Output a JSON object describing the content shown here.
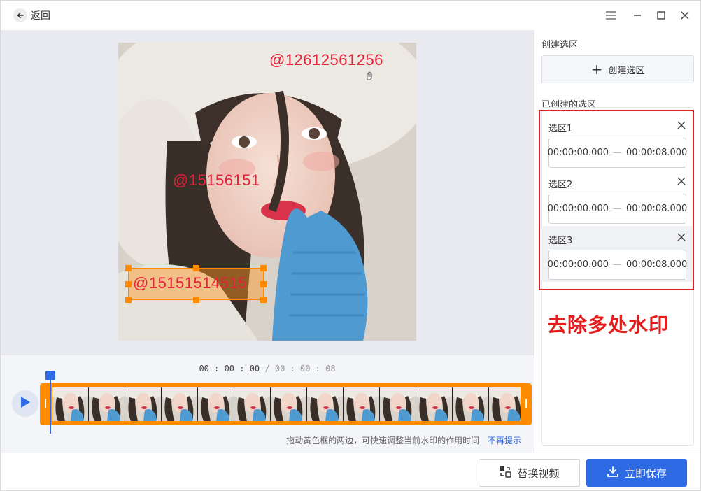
{
  "titlebar": {
    "back_label": "返回",
    "icons": [
      "back-arrow-icon",
      "menu-icon",
      "minimize-icon",
      "maximize-icon",
      "close-icon"
    ]
  },
  "preview": {
    "watermarks": [
      "@12612561256",
      "@15156151",
      "@15151514515"
    ]
  },
  "timeline": {
    "current_time": "00 : 00 : 00",
    "separator": " / ",
    "total_time": "00 : 00 : 08",
    "hint_text": "拖动黄色框的两边，可快速调整当前水印的作用时间",
    "hint_link": "不再提示"
  },
  "panel": {
    "create_section_title": "创建选区",
    "create_button_label": "创建选区",
    "created_section_title": "已创建的选区",
    "selections": [
      {
        "name": "选区1",
        "start": "00:00:00.000",
        "end": "00:00:08.000"
      },
      {
        "name": "选区2",
        "start": "00:00:00.000",
        "end": "00:00:08.000"
      },
      {
        "name": "选区3",
        "start": "00:00:00.000",
        "end": "00:00:08.000"
      }
    ],
    "promo_text": "去除多处水印"
  },
  "footer": {
    "replace_label": "替换视频",
    "save_label": "立即保存"
  },
  "colors": {
    "accent": "#2f6ae5",
    "selection_orange": "#ff8c00",
    "watermark_red": "#e8203a",
    "highlight_red": "#e02020"
  }
}
